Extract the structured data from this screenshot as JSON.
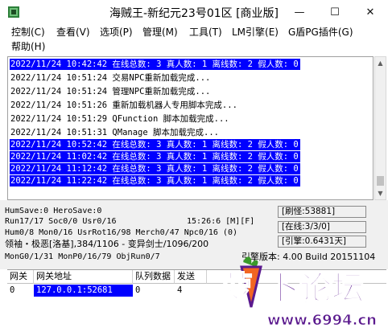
{
  "window": {
    "title": "海贼王-新纪元23号01区 [商业版]",
    "controls": {
      "minimize": "—",
      "maximize": "☐",
      "close": "✕"
    }
  },
  "menu": [
    {
      "label": "控制(C)"
    },
    {
      "label": "查看(V)"
    },
    {
      "label": "选项(P)"
    },
    {
      "label": "管理(M)"
    },
    {
      "label": "工具(T)"
    },
    {
      "label": "LM引擎(E)"
    },
    {
      "label": "G盾PG插件(G)"
    },
    {
      "label": "帮助(H)"
    }
  ],
  "log": [
    {
      "text": "2022/11/24 10:42:42 在线总数: 3 真人数: 1 离线数: 2 假人数: 0",
      "highlight": true
    },
    {
      "text": "2022/11/24 10:51:24 交易NPC重新加载完成...",
      "highlight": false
    },
    {
      "text": "2022/11/24 10:51:24 管理NPC重新加载完成...",
      "highlight": false
    },
    {
      "text": "2022/11/24 10:51:26 重新加载机器人专用脚本完成...",
      "highlight": false
    },
    {
      "text": "2022/11/24 10:51:29 QFunction 脚本加载完成...",
      "highlight": false
    },
    {
      "text": "2022/11/24 10:51:31 QManage 脚本加载完成...",
      "highlight": false
    },
    {
      "text": "2022/11/24 10:52:42 在线总数: 3 真人数: 1 离线数: 2 假人数: 0",
      "highlight": true
    },
    {
      "text": "2022/11/24 11:02:42 在线总数: 3 真人数: 1 离线数: 2 假人数: 0",
      "highlight": true
    },
    {
      "text": "2022/11/24 11:12:42 在线总数: 3 真人数: 1 离线数: 2 假人数: 0",
      "highlight": true
    },
    {
      "text": "2022/11/24 11:22:42 在线总数: 3 真人数: 1 离线数: 2 假人数: 0",
      "highlight": true
    }
  ],
  "status": {
    "save": "HumSave:0 HeroSave:0",
    "run": "Run17/17 Soc0/0 Usr0/16",
    "time": "15:26:6 [M][F]",
    "hum": "Hum0/8 Mon0/16 UsrRot16/98 Merch0/47 Npc0/16 (0)",
    "leader": "领袖・极恶[洛基],384/1106 - 变异剑士/1096/200",
    "mon": "MonG0/1/31 MonP0/16/79 ObjRun0/7",
    "refresh": "[刷怪:53881]",
    "online": "[在线:3/3/0]",
    "engine": "[引擎:0.6431天]",
    "version": "引擎版本: 4.00 Build 20151104"
  },
  "table": {
    "headers": [
      "网关",
      "网关地址",
      "队列数据",
      "发送",
      ""
    ],
    "rows": [
      [
        "0",
        "127.0.0.1:52681",
        "0",
        "4",
        ""
      ]
    ]
  },
  "watermark": {
    "name": "萝卜论坛",
    "url": "www.6994.cn"
  },
  "colors": {
    "highlight_bg": "#0000ff",
    "highlight_fg": "#ffffff",
    "watermark_purple": "#5b1a8e",
    "watermark_orange": "#f26522"
  }
}
